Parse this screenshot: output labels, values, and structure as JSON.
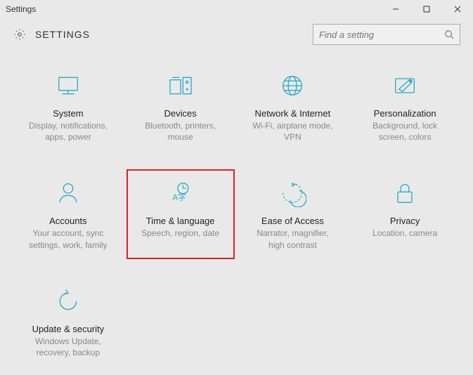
{
  "window": {
    "title": "Settings"
  },
  "header": {
    "title": "SETTINGS"
  },
  "search": {
    "placeholder": "Find a setting"
  },
  "tiles": [
    {
      "name": "System",
      "desc": "Display, notifications,\napps, power"
    },
    {
      "name": "Devices",
      "desc": "Bluetooth, printers,\nmouse"
    },
    {
      "name": "Network & Internet",
      "desc": "Wi-Fi, airplane mode,\nVPN"
    },
    {
      "name": "Personalization",
      "desc": "Background, lock\nscreen, colors"
    },
    {
      "name": "Accounts",
      "desc": "Your account, sync\nsettings, work, family"
    },
    {
      "name": "Time & language",
      "desc": "Speech, region, date"
    },
    {
      "name": "Ease of Access",
      "desc": "Narrator, magnifier,\nhigh contrast"
    },
    {
      "name": "Privacy",
      "desc": "Location, camera"
    },
    {
      "name": "Update & security",
      "desc": "Windows Update,\nrecovery, backup"
    }
  ]
}
